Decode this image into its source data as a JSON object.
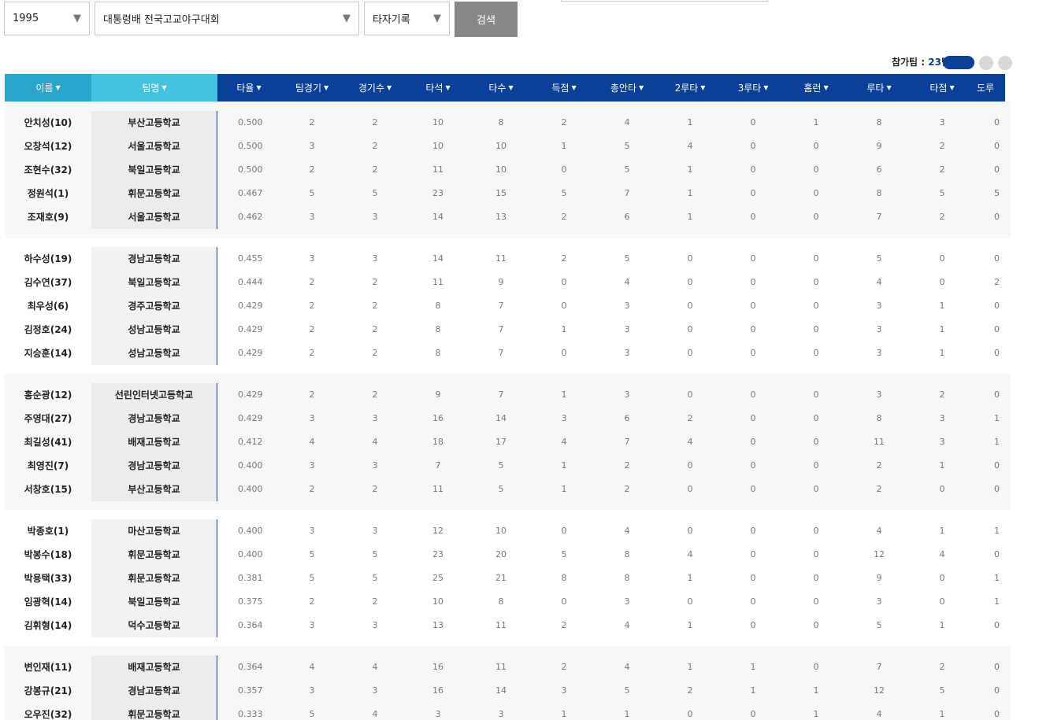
{
  "filters": {
    "year": "1995",
    "tournament": "대통령배 전국고교야구대회",
    "record_type": "타자기록",
    "search_label": "검색"
  },
  "summary": {
    "teams_label": "참가팀 : ",
    "teams_count": "23",
    "teams_suffix": "팀"
  },
  "columns": {
    "name": "이름",
    "team": "팀명",
    "avg": "타율",
    "team_games": "팀경기",
    "games": "경기수",
    "pa": "타석",
    "ab": "타수",
    "runs": "득점",
    "hits": "총안타",
    "doubles": "2루타",
    "triples": "3루타",
    "hr": "홈런",
    "tb": "루타",
    "rbi": "타점",
    "sb": "도루"
  },
  "sort_arrow": "▼",
  "groups": [
    [
      [
        "안치성(10)",
        "부산고등학교",
        "0.500",
        "2",
        "2",
        "10",
        "8",
        "2",
        "4",
        "1",
        "0",
        "1",
        "8",
        "3",
        "0"
      ],
      [
        "오창석(12)",
        "서울고등학교",
        "0.500",
        "3",
        "2",
        "10",
        "10",
        "1",
        "5",
        "4",
        "0",
        "0",
        "9",
        "2",
        "0"
      ],
      [
        "조현수(32)",
        "북일고등학교",
        "0.500",
        "2",
        "2",
        "11",
        "10",
        "0",
        "5",
        "1",
        "0",
        "0",
        "6",
        "2",
        "0"
      ],
      [
        "정원석(1)",
        "휘문고등학교",
        "0.467",
        "5",
        "5",
        "23",
        "15",
        "5",
        "7",
        "1",
        "0",
        "0",
        "8",
        "5",
        "5"
      ],
      [
        "조재호(9)",
        "서울고등학교",
        "0.462",
        "3",
        "3",
        "14",
        "13",
        "2",
        "6",
        "1",
        "0",
        "0",
        "7",
        "2",
        "0"
      ]
    ],
    [
      [
        "하수성(19)",
        "경남고등학교",
        "0.455",
        "3",
        "3",
        "14",
        "11",
        "2",
        "5",
        "0",
        "0",
        "0",
        "5",
        "0",
        "0"
      ],
      [
        "김수연(37)",
        "북일고등학교",
        "0.444",
        "2",
        "2",
        "11",
        "9",
        "0",
        "4",
        "0",
        "0",
        "0",
        "4",
        "0",
        "2"
      ],
      [
        "최우성(6)",
        "경주고등학교",
        "0.429",
        "2",
        "2",
        "8",
        "7",
        "0",
        "3",
        "0",
        "0",
        "0",
        "3",
        "1",
        "0"
      ],
      [
        "김정호(24)",
        "성남고등학교",
        "0.429",
        "2",
        "2",
        "8",
        "7",
        "1",
        "3",
        "0",
        "0",
        "0",
        "3",
        "1",
        "0"
      ],
      [
        "지승훈(14)",
        "성남고등학교",
        "0.429",
        "2",
        "2",
        "8",
        "7",
        "0",
        "3",
        "0",
        "0",
        "0",
        "3",
        "1",
        "0"
      ]
    ],
    [
      [
        "홍순광(12)",
        "선린인터넷고등학교",
        "0.429",
        "2",
        "2",
        "9",
        "7",
        "1",
        "3",
        "0",
        "0",
        "0",
        "3",
        "2",
        "0"
      ],
      [
        "주영대(27)",
        "경남고등학교",
        "0.429",
        "3",
        "3",
        "16",
        "14",
        "3",
        "6",
        "2",
        "0",
        "0",
        "8",
        "3",
        "1"
      ],
      [
        "최길성(41)",
        "배재고등학교",
        "0.412",
        "4",
        "4",
        "18",
        "17",
        "4",
        "7",
        "4",
        "0",
        "0",
        "11",
        "3",
        "1"
      ],
      [
        "최영진(7)",
        "경남고등학교",
        "0.400",
        "3",
        "3",
        "7",
        "5",
        "1",
        "2",
        "0",
        "0",
        "0",
        "2",
        "1",
        "0"
      ],
      [
        "서창호(15)",
        "부산고등학교",
        "0.400",
        "2",
        "2",
        "11",
        "5",
        "1",
        "2",
        "0",
        "0",
        "0",
        "2",
        "0",
        "0"
      ]
    ],
    [
      [
        "박종호(1)",
        "마산고등학교",
        "0.400",
        "3",
        "3",
        "12",
        "10",
        "0",
        "4",
        "0",
        "0",
        "0",
        "4",
        "1",
        "1"
      ],
      [
        "박봉수(18)",
        "휘문고등학교",
        "0.400",
        "5",
        "5",
        "23",
        "20",
        "5",
        "8",
        "4",
        "0",
        "0",
        "12",
        "4",
        "0"
      ],
      [
        "박용택(33)",
        "휘문고등학교",
        "0.381",
        "5",
        "5",
        "25",
        "21",
        "8",
        "8",
        "1",
        "0",
        "0",
        "9",
        "0",
        "1"
      ],
      [
        "임광혁(14)",
        "북일고등학교",
        "0.375",
        "2",
        "2",
        "10",
        "8",
        "0",
        "3",
        "0",
        "0",
        "0",
        "3",
        "0",
        "1"
      ],
      [
        "김휘형(14)",
        "덕수고등학교",
        "0.364",
        "3",
        "3",
        "13",
        "11",
        "2",
        "4",
        "1",
        "0",
        "0",
        "5",
        "1",
        "0"
      ]
    ],
    [
      [
        "변인재(11)",
        "배재고등학교",
        "0.364",
        "4",
        "4",
        "16",
        "11",
        "2",
        "4",
        "1",
        "1",
        "0",
        "7",
        "2",
        "0"
      ],
      [
        "강봉규(21)",
        "경남고등학교",
        "0.357",
        "3",
        "3",
        "16",
        "14",
        "3",
        "5",
        "2",
        "1",
        "1",
        "12",
        "5",
        "0"
      ],
      [
        "오우진(32)",
        "휘문고등학교",
        "0.333",
        "5",
        "4",
        "3",
        "3",
        "1",
        "1",
        "0",
        "0",
        "1",
        "4",
        "1",
        "0"
      ]
    ]
  ]
}
